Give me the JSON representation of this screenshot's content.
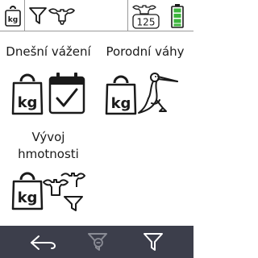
{
  "status_bar": {
    "weight_icon_label": "kg",
    "counter_value": "125",
    "battery_level": 1.0,
    "battery_color": "#3cb43c"
  },
  "tiles": [
    {
      "label": "Dnešní vážení",
      "icon": "daily-weighing-icon",
      "weight_label": "kg"
    },
    {
      "label": "Porodní váhy",
      "icon": "birth-weight-icon",
      "weight_label": "kg"
    },
    {
      "label": "Vývoj hmotnosti",
      "icon": "weight-development-icon",
      "weight_label": "kg"
    }
  ],
  "bottom_bar": {
    "background": "#3c3e4b",
    "buttons": [
      "back-arrow-icon",
      "filter-remove-icon",
      "filter-icon"
    ]
  }
}
